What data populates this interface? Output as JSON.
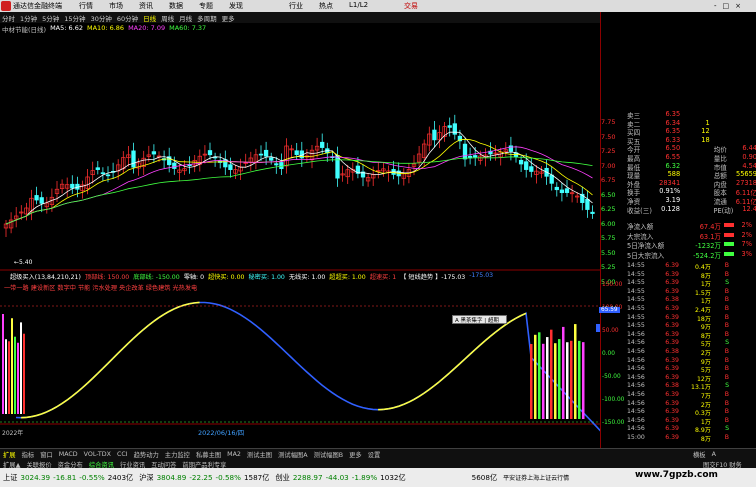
{
  "titlebar": {
    "app": "通达信金融终端",
    "menus": [
      "行情",
      "市场",
      "资讯",
      "数据",
      "专题",
      "发现",
      "交易",
      "行业",
      "热点",
      "L1/L2"
    ],
    "trade": "交易",
    "window_controls": [
      "-",
      "□",
      "×"
    ]
  },
  "periods": [
    "分时",
    "1分钟",
    "5分钟",
    "15分钟",
    "30分钟",
    "60分钟",
    "日线",
    "周线",
    "月线",
    "多周期",
    "更多"
  ],
  "active_period": "日线",
  "ma_legend": {
    "stock": "中材节能(日线)",
    "items": [
      {
        "label": "MA5: 6.62",
        "color": "#ffffff"
      },
      {
        "label": "MA10: 6.86",
        "color": "#ffff00"
      },
      {
        "label": "MA20: 7.09",
        "color": "#ff40ff"
      },
      {
        "label": "MA60: 7.37",
        "color": "#40ff40"
      }
    ]
  },
  "chart_labels": {
    "low_mark": "5.40",
    "popup": "A 黑茶集字 | 超期",
    "date_label": "2022/06/16/四",
    "bottom_year": "2022年"
  },
  "indicator_legend": {
    "items": [
      {
        "label": "超级买入(13,84,210,21)",
        "color": "#ffffff"
      },
      {
        "label": "顶部线: 150.00",
        "color": "#ff4040"
      },
      {
        "label": "底部线: -150.00",
        "color": "#40ff40"
      },
      {
        "label": "零轴: 0",
        "color": "#ffffff"
      },
      {
        "label": "超快买: 0.00",
        "color": "#ffff00"
      },
      {
        "label": "秘密买: 1.00",
        "color": "#40ffff"
      },
      {
        "label": "无线买: 1.00",
        "color": "#ffffff"
      },
      {
        "label": "超超买: 1.00",
        "color": "#ffff00"
      },
      {
        "label": "超速买: 1",
        "color": "#ff4040"
      },
      {
        "label": "【 短线趋势 】-175.03",
        "color": "#ffffff"
      },
      {
        "label": "-175.03",
        "color": "#4080ff"
      }
    ],
    "line2": "一带一路 建设新区 数字中 节能 污水处理 央企改革 绿色建筑 光热发电"
  },
  "price_axis_top": [
    "7.75",
    "7.50",
    "7.25",
    "7.00",
    "6.75",
    "6.50",
    "6.25",
    "6.00",
    "5.75",
    "5.50",
    "5.25",
    "5.00"
  ],
  "price_axis_ind": [
    "150.00",
    "100.00",
    "50.00",
    "0.00",
    "-50.00",
    "-100.00",
    "-150.00"
  ],
  "ind_marker": "65.59",
  "quote": [
    {
      "k": "卖三",
      "v1": "6.35",
      "v2": "",
      "k2": "",
      "v3": ""
    },
    {
      "k": "卖二",
      "v1": "6.34",
      "v2": "1",
      "k2": "",
      "v3": ""
    },
    {
      "k": "买四",
      "v1": "6.35",
      "v2": "12",
      "k2": "",
      "v3": ""
    },
    {
      "k": "买五",
      "v1": "6.33",
      "v2": "18",
      "k2": "",
      "v3": ""
    },
    {
      "k": "今开",
      "v1": "6.50",
      "v2": "",
      "k2": "均价",
      "v3": "6.44"
    },
    {
      "k": "最高",
      "v1": "6.55",
      "v2": "",
      "k2": "量比",
      "v3": "0.90"
    },
    {
      "k": "最低",
      "v1": "6.32",
      "v2": "",
      "k2": "市值",
      "v3": "4.54"
    },
    {
      "k": "现量",
      "v1": "588",
      "v2": "",
      "k2": "总额",
      "v3": "55659"
    },
    {
      "k": "外盘",
      "v1": "28341",
      "v2": "",
      "k2": "内盘",
      "v3": "27318"
    },
    {
      "k": "换手",
      "v1": "0.91%",
      "v2": "",
      "k2": "股本",
      "v3": "6.11亿"
    },
    {
      "k": "净资",
      "v1": "3.19",
      "v2": "",
      "k2": "流通",
      "v3": "6.11亿"
    },
    {
      "k": "收益(三)",
      "v1": "0.128",
      "v2": "",
      "k2": "PE(动)",
      "v3": "12.4"
    }
  ],
  "flows": [
    {
      "k": "净流入额",
      "v": "67.4万",
      "pct": "2%"
    },
    {
      "k": "大宗流入",
      "v": "63.1万",
      "pct": "2%"
    },
    {
      "k": "5日净流入额",
      "v": "-1232万",
      "pct": "7%"
    },
    {
      "k": "5日大宗流入",
      "v": "-524.2万",
      "pct": "3%"
    }
  ],
  "ticks": [
    {
      "t": "14:55",
      "p": "6.39",
      "vol": "0.4万",
      "bs": "B"
    },
    {
      "t": "14:55",
      "p": "6.39",
      "vol": "8万",
      "bs": "B"
    },
    {
      "t": "14:55",
      "p": "6.39",
      "vol": "1万",
      "bs": "S"
    },
    {
      "t": "14:55",
      "p": "6.39",
      "vol": "1.5万",
      "bs": "B"
    },
    {
      "t": "14:55",
      "p": "6.38",
      "vol": "1万",
      "bs": "B"
    },
    {
      "t": "14:55",
      "p": "6.39",
      "vol": "2.4万",
      "bs": "B"
    },
    {
      "t": "14:55",
      "p": "6.39",
      "vol": "18万",
      "bs": "B"
    },
    {
      "t": "14:55",
      "p": "6.39",
      "vol": "9万",
      "bs": "B"
    },
    {
      "t": "14:56",
      "p": "6.39",
      "vol": "8万",
      "bs": "B"
    },
    {
      "t": "14:56",
      "p": "6.39",
      "vol": "5万",
      "bs": "S"
    },
    {
      "t": "14:56",
      "p": "6.38",
      "vol": "2万",
      "bs": "B"
    },
    {
      "t": "14:56",
      "p": "6.39",
      "vol": "9万",
      "bs": "B"
    },
    {
      "t": "14:56",
      "p": "6.39",
      "vol": "5万",
      "bs": "B"
    },
    {
      "t": "14:56",
      "p": "6.39",
      "vol": "12万",
      "bs": "B"
    },
    {
      "t": "14:56",
      "p": "6.38",
      "vol": "13.1万",
      "bs": "S"
    },
    {
      "t": "14:56",
      "p": "6.39",
      "vol": "7万",
      "bs": "B"
    },
    {
      "t": "14:56",
      "p": "6.39",
      "vol": "2万",
      "bs": "B"
    },
    {
      "t": "14:56",
      "p": "6.39",
      "vol": "0.3万",
      "bs": "B"
    },
    {
      "t": "14:56",
      "p": "6.39",
      "vol": "1万",
      "bs": "B"
    },
    {
      "t": "14:56",
      "p": "6.39",
      "vol": "8.9万",
      "bs": "S"
    },
    {
      "t": "15:00",
      "p": "6.39",
      "vol": "8万",
      "bs": "B"
    }
  ],
  "tabs_row1": [
    "扩展",
    "指标",
    "窗口",
    "MACD",
    "VOL-TDX",
    "CCI",
    "趋势动力",
    "主力监控",
    "私募主图",
    "MA2",
    "测试主图",
    "测试幅图A",
    "测试幅图B",
    "更多",
    "设置"
  ],
  "tabs_row2": [
    "扩展▲",
    "关联报价",
    "资金分布",
    "综合资讯",
    "行业资讯",
    "互动问答",
    "前期产品利专享"
  ],
  "tabs_right": [
    "横板",
    "A"
  ],
  "tabs_right2": "图交F10 财务",
  "status": [
    {
      "name": "上证",
      "val": "3024.39",
      "chg": "-16.81",
      "pct": "-0.55%",
      "amt": "2403亿"
    },
    {
      "name": "沪深",
      "val": "3804.89",
      "chg": "-22.25",
      "pct": "-0.58%",
      "amt": "1587亿"
    },
    {
      "name": "创业",
      "val": "2288.97",
      "chg": "-44.03",
      "pct": "-1.89%",
      "amt": "1032亿"
    }
  ],
  "status_right": {
    "amt": "5608亿",
    "text": "平安证券上海上证云行情"
  },
  "watermark": "www.7gpzb.com"
}
